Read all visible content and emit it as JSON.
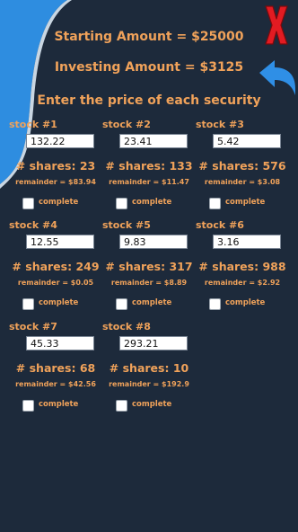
{
  "header": {
    "starting": "Starting Amount = $25000",
    "investing": "Investing Amount = $3125",
    "instruction": "Enter the price of each security"
  },
  "icons": {
    "close": "close-x-icon",
    "back": "back-arrow-icon",
    "close_color": "#e21b22",
    "back_color": "#2f8fe6"
  },
  "colors": {
    "background": "#1d2a3b",
    "accent": "#f0a25a",
    "swoosh": "#2e8de0"
  },
  "stocks": [
    {
      "label": "stock #1",
      "price": "132.22",
      "shares": "# shares: 23",
      "remainder": "remainder = $83.94",
      "complete_label": "complete"
    },
    {
      "label": "stock #2",
      "price": "23.41",
      "shares": "# shares: 133",
      "remainder": "remainder = $11.47",
      "complete_label": "complete"
    },
    {
      "label": "stock #3",
      "price": "5.42",
      "shares": "# shares: 576",
      "remainder": "remainder = $3.08",
      "complete_label": "complete"
    },
    {
      "label": "stock #4",
      "price": "12.55",
      "shares": "# shares: 249",
      "remainder": "remainder = $0.05",
      "complete_label": "complete"
    },
    {
      "label": "stock #5",
      "price": "9.83",
      "shares": "# shares: 317",
      "remainder": "remainder = $8.89",
      "complete_label": "complete"
    },
    {
      "label": "stock #6",
      "price": "3.16",
      "shares": "# shares: 988",
      "remainder": "remainder = $2.92",
      "complete_label": "complete"
    },
    {
      "label": "stock #7",
      "price": "45.33",
      "shares": "# shares: 68",
      "remainder": "remainder = $42.56",
      "complete_label": "complete"
    },
    {
      "label": "stock #8",
      "price": "293.21",
      "shares": "# shares: 10",
      "remainder": "remainder = $192.9",
      "complete_label": "complete"
    }
  ]
}
